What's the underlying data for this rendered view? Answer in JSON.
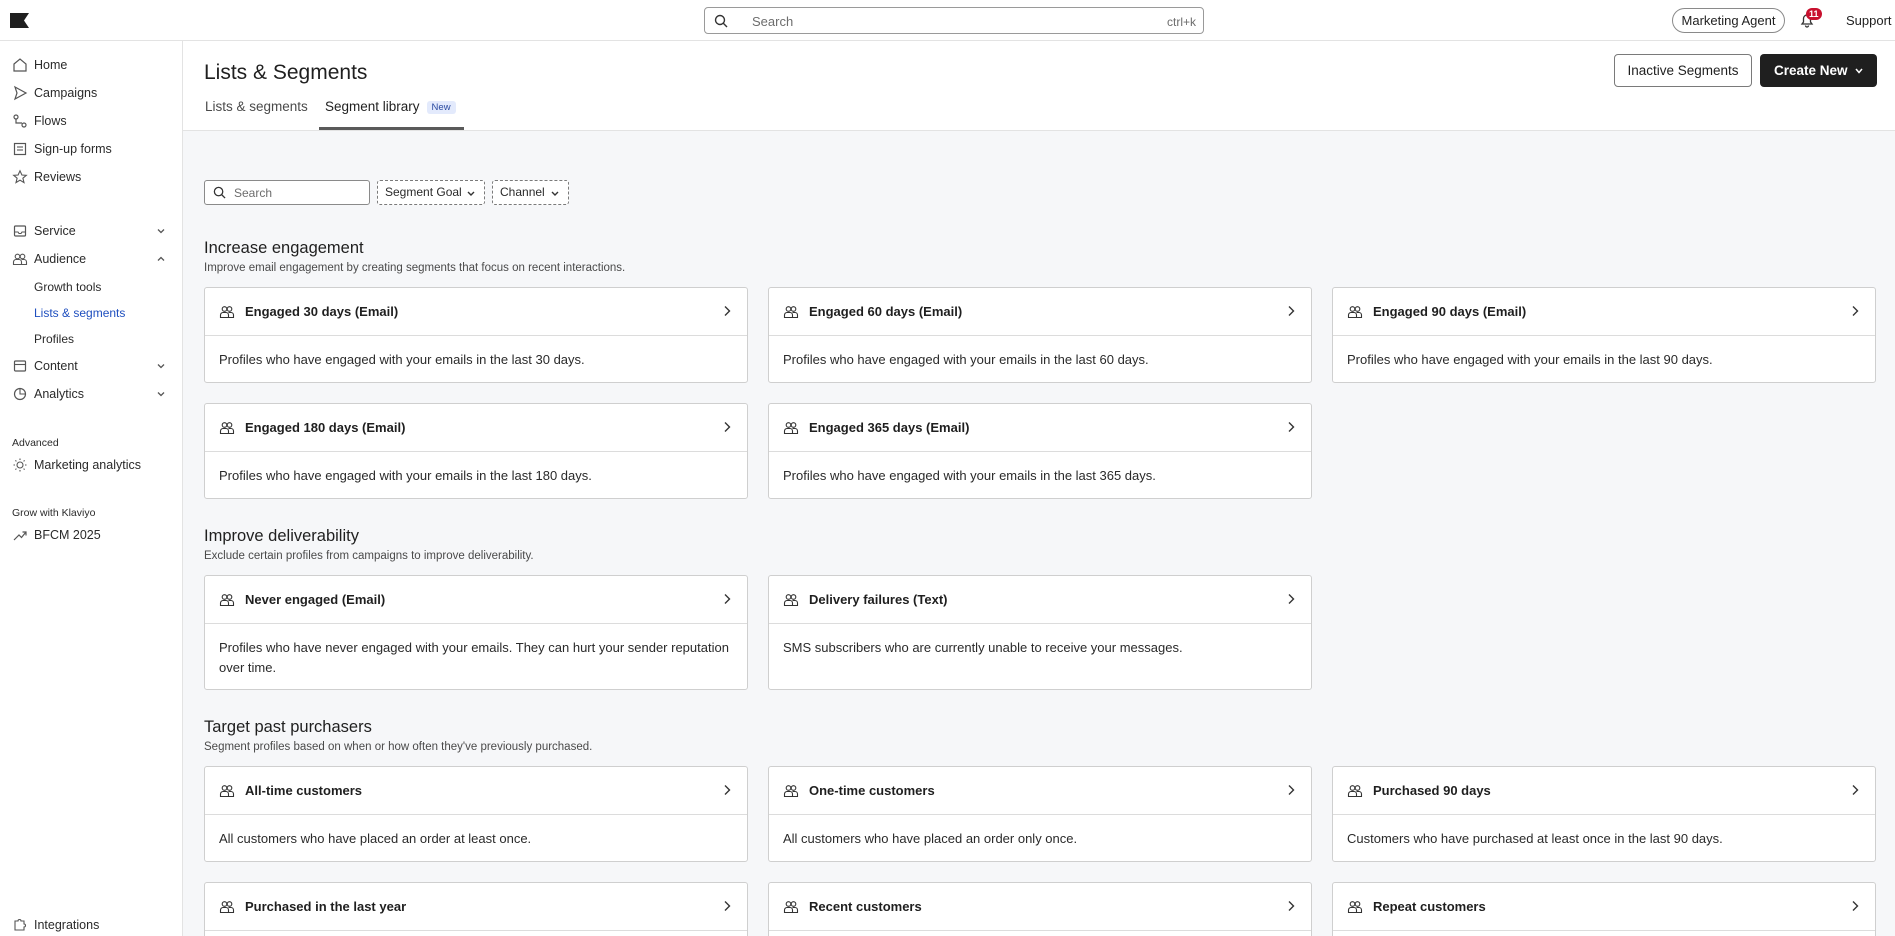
{
  "topbar": {
    "search_placeholder": "Search",
    "search_shortcut": "ctrl+k",
    "agent_button": "Marketing Agent",
    "notification_count": "11",
    "support_label": "Support"
  },
  "sidebar": {
    "items": [
      {
        "label": "Home",
        "icon": "home-icon"
      },
      {
        "label": "Campaigns",
        "icon": "send-icon"
      },
      {
        "label": "Flows",
        "icon": "flow-icon"
      },
      {
        "label": "Sign-up forms",
        "icon": "form-icon"
      },
      {
        "label": "Reviews",
        "icon": "star-icon"
      },
      {
        "label": "Service",
        "icon": "inbox-icon"
      },
      {
        "label": "Audience",
        "icon": "users-icon"
      },
      {
        "label": "Content",
        "icon": "folder-icon"
      },
      {
        "label": "Analytics",
        "icon": "chart-icon"
      }
    ],
    "audience_sub": [
      "Growth tools",
      "Lists & segments",
      "Profiles"
    ],
    "advanced_label": "Advanced",
    "marketing_analytics": "Marketing analytics",
    "grow_label": "Grow with Klaviyo",
    "bfcm": "BFCM 2025",
    "integrations": "Integrations"
  },
  "header": {
    "title": "Lists & Segments",
    "tabs": [
      "Lists & segments",
      "Segment library"
    ],
    "new_badge": "New",
    "inactive_button": "Inactive Segments",
    "create_button": "Create New"
  },
  "filters": {
    "search_placeholder": "Search",
    "goal": "Segment Goal",
    "channel": "Channel"
  },
  "sections": [
    {
      "title": "Increase engagement",
      "desc": "Improve email engagement by creating segments that focus on recent interactions.",
      "cards": [
        {
          "title": "Engaged 30 days (Email)",
          "desc": "Profiles who have engaged with your emails in the last 30 days."
        },
        {
          "title": "Engaged 60 days (Email)",
          "desc": "Profiles who have engaged with your emails in the last 60 days."
        },
        {
          "title": "Engaged 90 days (Email)",
          "desc": "Profiles who have engaged with your emails in the last 90 days."
        },
        {
          "title": "Engaged 180 days (Email)",
          "desc": "Profiles who have engaged with your emails in the last 180 days."
        },
        {
          "title": "Engaged 365 days (Email)",
          "desc": "Profiles who have engaged with your emails in the last 365 days."
        }
      ]
    },
    {
      "title": "Improve deliverability",
      "desc": "Exclude certain profiles from campaigns to improve deliverability.",
      "cards": [
        {
          "title": "Never engaged (Email)",
          "desc": "Profiles who have never engaged with your emails. They can hurt your sender reputation over time."
        },
        {
          "title": "Delivery failures (Text)",
          "desc": "SMS subscribers who are currently unable to receive your messages."
        }
      ]
    },
    {
      "title": "Target past purchasers",
      "desc": "Segment profiles based on when or how often they've previously purchased.",
      "cards": [
        {
          "title": "All-time customers",
          "desc": "All customers who have placed an order at least once."
        },
        {
          "title": "One-time customers",
          "desc": "All customers who have placed an order only once."
        },
        {
          "title": "Purchased 90 days",
          "desc": "Customers who have purchased at least once in the last 90 days."
        },
        {
          "title": "Purchased in the last year",
          "desc": ""
        },
        {
          "title": "Recent customers",
          "desc": ""
        },
        {
          "title": "Repeat customers",
          "desc": ""
        }
      ]
    }
  ]
}
